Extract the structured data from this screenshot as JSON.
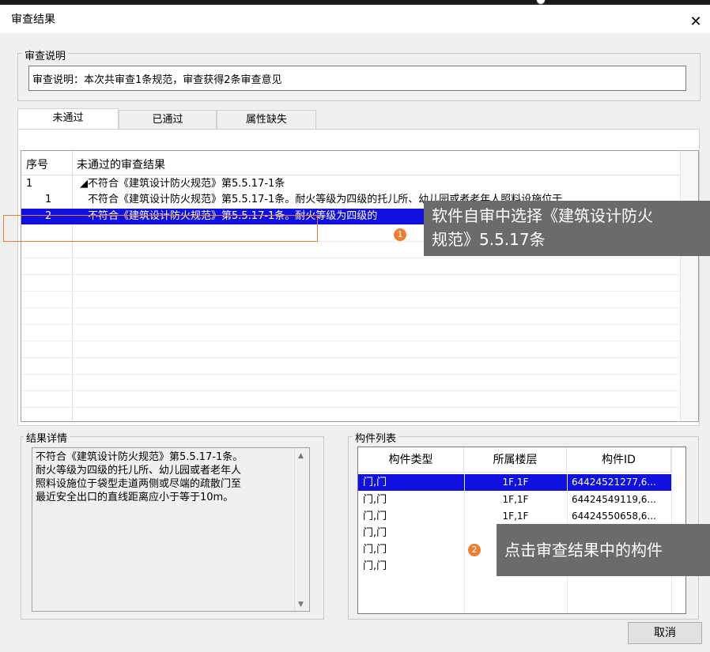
{
  "window": {
    "title": "审查结果"
  },
  "description": {
    "legend": "审查说明",
    "text": "审查说明：本次共审查1条规范，审查获得2条审查意见"
  },
  "tabs": [
    {
      "label": "未通过"
    },
    {
      "label": "已通过"
    },
    {
      "label": "属性缺失"
    }
  ],
  "results": {
    "headers": {
      "index": "序号",
      "result": "未通过的审查结果"
    },
    "rows": [
      {
        "index": "1",
        "text": "◢不符合《建筑设计防火规范》第5.5.17-1条"
      },
      {
        "index": "1",
        "text": "不符合《建筑设计防火规范》第5.5.17-1条。耐火等级为四级的托儿所、幼儿园或者老年人照料设施位于"
      },
      {
        "index": "2",
        "text": "不符合《建筑设计防火规范》第5.5.17-1条。耐火等级为四级的"
      }
    ]
  },
  "details": {
    "legend": "结果详情",
    "lines": [
      "不符合《建筑设计防火规范》第5.5.17-1条。",
      "耐火等级为四级的托儿所、幼儿园或者老年人",
      "照料设施位于袋型走道两侧或尽端的疏散门至",
      "最近安全出口的直线距离应小于等于10m。"
    ]
  },
  "components": {
    "legend": "构件列表",
    "headers": {
      "type": "构件类型",
      "floor": "所属楼层",
      "id": "构件ID"
    },
    "rows": [
      {
        "type": "门,门",
        "floor": "1F,1F",
        "id": "64424521277,6..."
      },
      {
        "type": "门,门",
        "floor": "1F,1F",
        "id": "64424549119,6..."
      },
      {
        "type": "门,门",
        "floor": "1F,1F",
        "id": "64424550658,6..."
      },
      {
        "type": "门,门",
        "floor": "",
        "id": ""
      },
      {
        "type": "门,门",
        "floor": "",
        "id": ""
      },
      {
        "type": "门,门",
        "floor": "",
        "id": ""
      }
    ]
  },
  "callouts": {
    "one": {
      "badge": "1",
      "line1": "软件自审中选择《建筑设计防火",
      "line2": "规范》5.5.17条"
    },
    "two": {
      "badge": "2",
      "text": "点击审查结果中的构件"
    }
  },
  "buttons": {
    "cancel": "取消"
  },
  "colors": {
    "selection": "#1010e0",
    "callout_bg": "#6b6b6b",
    "accent": "#ed7d31"
  }
}
